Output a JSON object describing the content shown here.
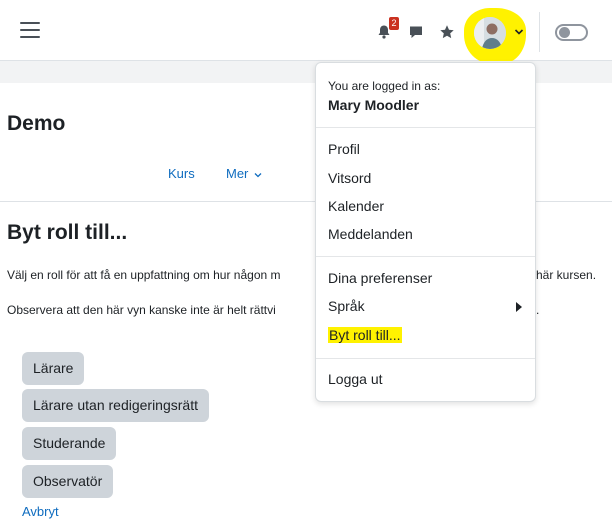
{
  "navbar": {
    "notification_count": "2"
  },
  "page": {
    "course_title": "Demo",
    "secondary_nav": {
      "kurs": "Kurs",
      "mer": "Mer"
    },
    "heading": "Byt roll till...",
    "paragraph1_visible": "Välj en roll för att få en uppfattning om hur någon m",
    "paragraph1_tail": "här kursen.",
    "paragraph2_visible": "Observera att den här vyn kanske inte är helt rättvi",
    "paragraph2_tail": ".",
    "roles": [
      "Lärare",
      "Lärare utan redigeringsrätt",
      "Studerande",
      "Observatör"
    ],
    "cancel": "Avbryt"
  },
  "user_menu": {
    "logged_in_as": "You are logged in as:",
    "user_name": "Mary Moodler",
    "items": {
      "profil": "Profil",
      "vitsord": "Vitsord",
      "kalender": "Kalender",
      "meddelanden": "Meddelanden",
      "preferenser": "Dina preferenser",
      "sprak": "Språk",
      "byt_roll": "Byt roll till...",
      "logga_ut": "Logga ut"
    }
  },
  "colors": {
    "highlight": "#fff200",
    "link": "#0f6cbf",
    "role_button": "#ced4da",
    "badge": "#ca3120"
  },
  "icons": [
    "menu-icon",
    "bell-icon",
    "chat-icon",
    "star-icon",
    "user-avatar",
    "chevron-down-icon",
    "dark-mode-toggle",
    "chevron-right-icon"
  ]
}
